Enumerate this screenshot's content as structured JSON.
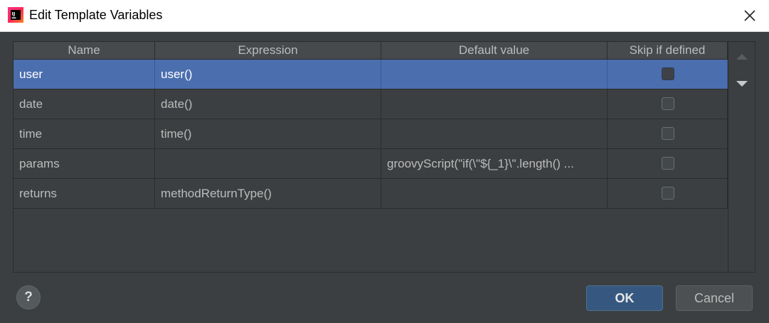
{
  "window": {
    "title": "Edit Template Variables"
  },
  "table": {
    "columns": [
      "Name",
      "Expression",
      "Default value",
      "Skip if defined"
    ],
    "rows": [
      {
        "name": "user",
        "expression": "user()",
        "default": "",
        "skip": false
      },
      {
        "name": "date",
        "expression": "date()",
        "default": "",
        "skip": false
      },
      {
        "name": "time",
        "expression": "time()",
        "default": "",
        "skip": false
      },
      {
        "name": "params",
        "expression": "",
        "default": "groovyScript(\"if(\\\"${_1}\\\".length() ...",
        "skip": false
      },
      {
        "name": "returns",
        "expression": "methodReturnType()",
        "default": "",
        "skip": false
      }
    ],
    "selected_row": 0
  },
  "buttons": {
    "help": "?",
    "ok": "OK",
    "cancel": "Cancel"
  },
  "icons": {
    "app": "intellij-logo-icon",
    "close": "close-icon",
    "move_up": "triangle-up-icon",
    "move_down": "triangle-down-icon"
  },
  "colors": {
    "background": "#3c3f41",
    "selection": "#4b6eaf",
    "ok_button": "#365880"
  }
}
